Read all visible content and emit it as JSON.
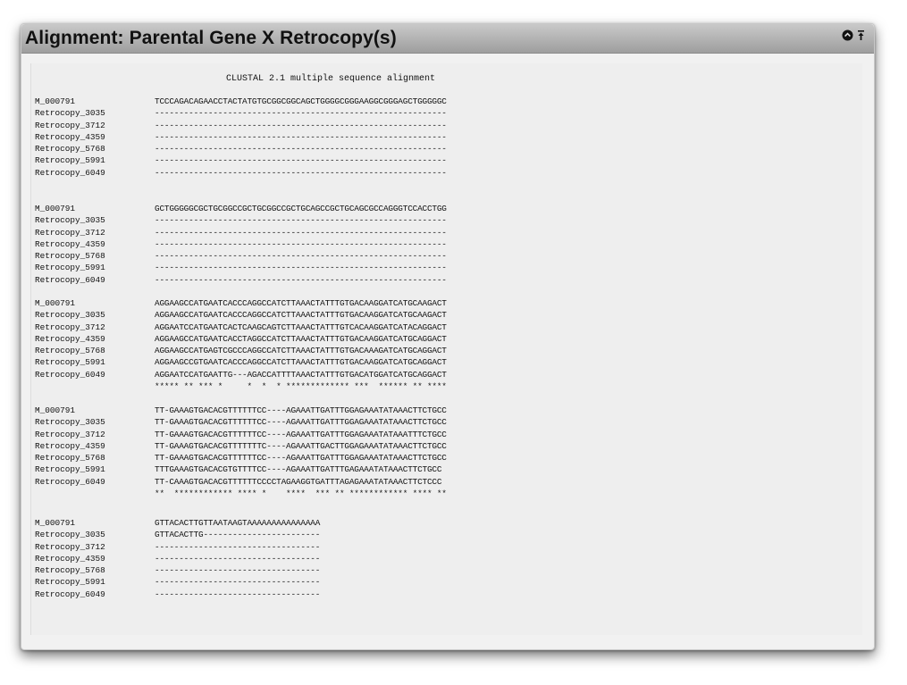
{
  "window": {
    "title": "Alignment: Parental Gene X Retrocopy(s)",
    "icons": [
      "collapse-circle-icon",
      "pin-icon"
    ]
  },
  "alignment": {
    "header": "CLUSTAL 2.1 multiple sequence alignment",
    "blocks": [
      {
        "rows": [
          {
            "name": "M_000791",
            "seq": "TCCCAGACAGAACCTACTATGTGCGGCGGCAGCTGGGGCGGGAAGGCGGGAGCTGGGGGC"
          },
          {
            "name": "Retrocopy_3035",
            "seq": "------------------------------------------------------------"
          },
          {
            "name": "Retrocopy_3712",
            "seq": "------------------------------------------------------------"
          },
          {
            "name": "Retrocopy_4359",
            "seq": "------------------------------------------------------------"
          },
          {
            "name": "Retrocopy_5768",
            "seq": "------------------------------------------------------------"
          },
          {
            "name": "Retrocopy_5991",
            "seq": "------------------------------------------------------------"
          },
          {
            "name": "Retrocopy_6049",
            "seq": "------------------------------------------------------------"
          }
        ],
        "consensus": ""
      },
      {
        "rows": [
          {
            "name": "M_000791",
            "seq": "GCTGGGGGCGCTGCGGCCGCTGCGGCCGCTGCAGCCGCTGCAGCGCCAGGGTCCACCTGG"
          },
          {
            "name": "Retrocopy_3035",
            "seq": "------------------------------------------------------------"
          },
          {
            "name": "Retrocopy_3712",
            "seq": "------------------------------------------------------------"
          },
          {
            "name": "Retrocopy_4359",
            "seq": "------------------------------------------------------------"
          },
          {
            "name": "Retrocopy_5768",
            "seq": "------------------------------------------------------------"
          },
          {
            "name": "Retrocopy_5991",
            "seq": "------------------------------------------------------------"
          },
          {
            "name": "Retrocopy_6049",
            "seq": "------------------------------------------------------------"
          }
        ],
        "consensus": ""
      },
      {
        "rows": [
          {
            "name": "M_000791",
            "seq": "AGGAAGCCATGAATCACCCAGGCCATCTTAAACTATTTGTGACAAGGATCATGCAAGACT"
          },
          {
            "name": "Retrocopy_3035",
            "seq": "AGGAAGCCATGAATCACCCAGGCCATCTTAAACTATTTGTGACAAGGATCATGCAAGACT"
          },
          {
            "name": "Retrocopy_3712",
            "seq": "AGGAATCCATGAATCACTCAAGCAGTCTTAAACTATTTGTCACAAGGATCATACAGGACT"
          },
          {
            "name": "Retrocopy_4359",
            "seq": "AGGAAGCCATGAATCACCTAGGCCATCTTAAACTATTTGTGACAAGGATCATGCAGGACT"
          },
          {
            "name": "Retrocopy_5768",
            "seq": "AGGAAGCCATGAGTCGCCCAGGCCATCTTAAACTATTTGTGACAAAGATCATGCAGGACT"
          },
          {
            "name": "Retrocopy_5991",
            "seq": "AGGAAGCCGTGAATCACCCAGGCCATCTTAAACTATTTGTGACAAGGATCATGCAGGACT"
          },
          {
            "name": "Retrocopy_6049",
            "seq": "AGGAATCCATGAATTG---AGACCATTTTAAACTATTTGTGACATGGATCATGCAGGACT"
          }
        ],
        "consensus": "***** ** *** *     *  *  * ************* ***  ****** ** ****"
      },
      {
        "rows": [
          {
            "name": "M_000791",
            "seq": "TT-GAAAGTGACACGTTTTTTCC----AGAAATTGATTTGGAGAAATATAAACTTCTGCC"
          },
          {
            "name": "Retrocopy_3035",
            "seq": "TT-GAAAGTGACACGTTTTTTCC----AGAAATTGATTTGGAGAAATATAAACTTCTGCC"
          },
          {
            "name": "Retrocopy_3712",
            "seq": "TT-GAAAGTGACACGTTTTTTCC----AGAAATTGATTTGGAGAAATATAAATTTCTGCC"
          },
          {
            "name": "Retrocopy_4359",
            "seq": "TT-GAAAGTGACACGTTTTTTTC----AGAAATTGACTTGGAGAAATATAAACTTCTGCC"
          },
          {
            "name": "Retrocopy_5768",
            "seq": "TT-GAAAGTGACACGTTTTTTCC----AGAAATTGATTTGGAGAAATATAAACTTCTGCC"
          },
          {
            "name": "Retrocopy_5991",
            "seq": "TTTGAAAGTGACACGTGTTTTCC----AGAAATTGATTTGAGAAATATAAACTTCTGCC"
          },
          {
            "name": "Retrocopy_6049",
            "seq": "TT-CAAAGTGACACGTTTTTTCCCCTAGAAGGTGATTTAGAGAAATATAAACTTCTCCC"
          }
        ],
        "consensus": "**  ************ **** *    ****  *** ** ************ **** **"
      },
      {
        "rows": [
          {
            "name": "M_000791",
            "seq": "GTTACACTTGTTAATAAGTAAAAAAAAAAAAAAA"
          },
          {
            "name": "Retrocopy_3035",
            "seq": "GTTACACTTG------------------------"
          },
          {
            "name": "Retrocopy_3712",
            "seq": "----------------------------------"
          },
          {
            "name": "Retrocopy_4359",
            "seq": "----------------------------------"
          },
          {
            "name": "Retrocopy_5768",
            "seq": "----------------------------------"
          },
          {
            "name": "Retrocopy_5991",
            "seq": "----------------------------------"
          },
          {
            "name": "Retrocopy_6049",
            "seq": "----------------------------------"
          }
        ],
        "consensus": ""
      }
    ]
  }
}
